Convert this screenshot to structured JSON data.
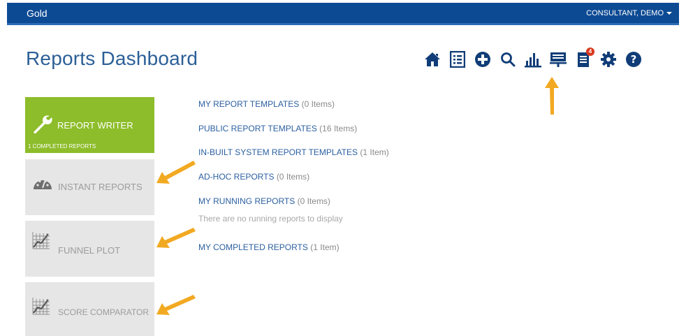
{
  "header": {
    "brand": "Gold",
    "user": "CONSULTANT, DEMO"
  },
  "page": {
    "title": "Reports Dashboard"
  },
  "toolbar": {
    "icons": [
      "home-icon",
      "list-icon",
      "add-icon",
      "search-icon",
      "bar-chart-icon",
      "presentation-icon",
      "notes-icon",
      "settings-icon",
      "help-icon"
    ],
    "notes_badge": "4"
  },
  "tiles": {
    "report_writer": {
      "label": "REPORT WRITER",
      "sub": "1 COMPLETED REPORTS"
    },
    "instant_reports": {
      "label": "INSTANT REPORTS"
    },
    "funnel_plot": {
      "label": "FUNNEL PLOT"
    },
    "score_comparator": {
      "label": "SCORE COMPARATOR"
    }
  },
  "links": [
    {
      "label": "MY REPORT TEMPLATES",
      "count": "(0 Items)"
    },
    {
      "label": "PUBLIC REPORT TEMPLATES",
      "count": "(16 Items)"
    },
    {
      "label": "IN-BUILT SYSTEM REPORT TEMPLATES",
      "count": "(1 Item)"
    },
    {
      "label": "AD-HOC REPORTS",
      "count": "(0 Items)"
    },
    {
      "label": "MY RUNNING REPORTS",
      "count": "(0 Items)"
    },
    {
      "label": "MY COMPLETED REPORTS",
      "count": "(1 Item)"
    }
  ],
  "running_empty_text": "There are no running reports to display",
  "colors": {
    "header": "#0d4a94",
    "accent_green": "#8dbd2a",
    "link_blue": "#2b5fa0",
    "arrow": "#f2a922",
    "title": "#2c5f97"
  }
}
